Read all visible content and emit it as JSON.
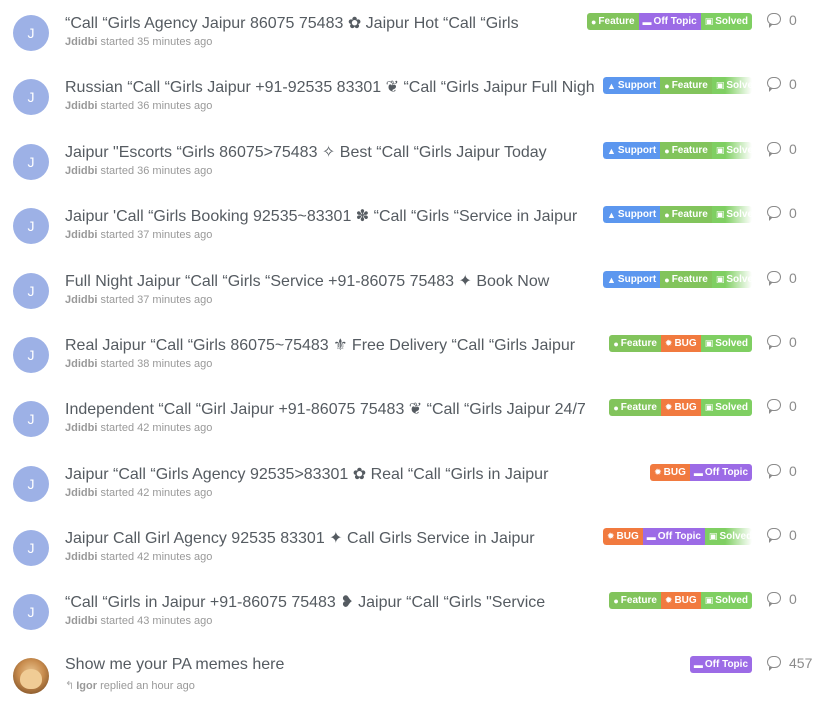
{
  "discussions": [
    {
      "avatar_letter": "J",
      "title": "“Call “Girls Agency Jaipur 86075 75483 ✿ Jaipur Hot “Call “Girls",
      "user": "Jdidbi",
      "action": "started 35 minutes ago",
      "tags": [
        {
          "label": "Feature",
          "kind": "feature",
          "icon": "lightbulb-icon"
        },
        {
          "label": "Off Topic",
          "kind": "offtopic",
          "icon": "chat-icon"
        },
        {
          "label": "Solved",
          "kind": "solved",
          "icon": "clipboard-check-icon"
        }
      ],
      "comments": "0"
    },
    {
      "avatar_letter": "J",
      "title": "Russian “Call “Girls Jaipur +91-92535 83301 ❦ “Call “Girls Jaipur Full Night",
      "user": "Jdidbi",
      "action": "started 36 minutes ago",
      "tags": [
        {
          "label": "Support",
          "kind": "support",
          "icon": "person-icon"
        },
        {
          "label": "Feature",
          "kind": "feature",
          "icon": "lightbulb-icon"
        },
        {
          "label": "Solved",
          "kind": "solved",
          "icon": "clipboard-check-icon"
        }
      ],
      "comments": "0"
    },
    {
      "avatar_letter": "J",
      "title": "Jaipur \"Escorts “Girls 86075>75483 ✧ Best “Call “Girls Jaipur Today",
      "user": "Jdidbi",
      "action": "started 36 minutes ago",
      "tags": [
        {
          "label": "Support",
          "kind": "support",
          "icon": "person-icon"
        },
        {
          "label": "Feature",
          "kind": "feature",
          "icon": "lightbulb-icon"
        },
        {
          "label": "Solved",
          "kind": "solved",
          "icon": "clipboard-check-icon"
        }
      ],
      "comments": "0"
    },
    {
      "avatar_letter": "J",
      "title": "Jaipur 'Call “Girls Booking 92535~83301 ✽ “Call “Girls “Service in Jaipur",
      "user": "Jdidbi",
      "action": "started 37 minutes ago",
      "tags": [
        {
          "label": "Support",
          "kind": "support",
          "icon": "person-icon"
        },
        {
          "label": "Feature",
          "kind": "feature",
          "icon": "lightbulb-icon"
        },
        {
          "label": "Solved",
          "kind": "solved",
          "icon": "clipboard-check-icon"
        }
      ],
      "comments": "0"
    },
    {
      "avatar_letter": "J",
      "title": "Full Night Jaipur “Call “Girls “Service +91-86075 75483 ✦ Book Now",
      "user": "Jdidbi",
      "action": "started 37 minutes ago",
      "tags": [
        {
          "label": "Support",
          "kind": "support",
          "icon": "person-icon"
        },
        {
          "label": "Feature",
          "kind": "feature",
          "icon": "lightbulb-icon"
        },
        {
          "label": "Solved",
          "kind": "solved",
          "icon": "clipboard-check-icon"
        }
      ],
      "comments": "0"
    },
    {
      "avatar_letter": "J",
      "title": "Real Jaipur “Call “Girls 86075~75483 ⚜ Free Delivery “Call “Girls Jaipur",
      "user": "Jdidbi",
      "action": "started 38 minutes ago",
      "tags": [
        {
          "label": "Feature",
          "kind": "feature",
          "icon": "lightbulb-icon"
        },
        {
          "label": "BUG",
          "kind": "bug",
          "icon": "bug-icon"
        },
        {
          "label": "Solved",
          "kind": "solved",
          "icon": "clipboard-check-icon"
        }
      ],
      "comments": "0"
    },
    {
      "avatar_letter": "J",
      "title": "Independent “Call “Girl Jaipur +91-86075 75483 ❦ “Call “Girls Jaipur 24/7",
      "user": "Jdidbi",
      "action": "started 42 minutes ago",
      "tags": [
        {
          "label": "Feature",
          "kind": "feature",
          "icon": "lightbulb-icon"
        },
        {
          "label": "BUG",
          "kind": "bug",
          "icon": "bug-icon"
        },
        {
          "label": "Solved",
          "kind": "solved",
          "icon": "clipboard-check-icon"
        }
      ],
      "comments": "0"
    },
    {
      "avatar_letter": "J",
      "title": "Jaipur “Call “Girls Agency 92535>83301 ✿ Real “Call “Girls in Jaipur",
      "user": "Jdidbi",
      "action": "started 42 minutes ago",
      "tags": [
        {
          "label": "BUG",
          "kind": "bug",
          "icon": "bug-icon"
        },
        {
          "label": "Off Topic",
          "kind": "offtopic",
          "icon": "chat-icon"
        }
      ],
      "comments": "0"
    },
    {
      "avatar_letter": "J",
      "title": "Jaipur Call Girl Agency 92535 83301 ✦ Call Girls Service in Jaipur",
      "user": "Jdidbi",
      "action": "started 42 minutes ago",
      "tags": [
        {
          "label": "BUG",
          "kind": "bug",
          "icon": "bug-icon"
        },
        {
          "label": "Off Topic",
          "kind": "offtopic",
          "icon": "chat-icon"
        },
        {
          "label": "Solved",
          "kind": "solved",
          "icon": "clipboard-check-icon"
        }
      ],
      "comments": "0"
    },
    {
      "avatar_letter": "J",
      "title": "“Call “Girls in Jaipur +91-86075 75483 ❥ Jaipur “Call “Girls \"Service",
      "user": "Jdidbi",
      "action": "started 43 minutes ago",
      "tags": [
        {
          "label": "Feature",
          "kind": "feature",
          "icon": "lightbulb-icon"
        },
        {
          "label": "BUG",
          "kind": "bug",
          "icon": "bug-icon"
        },
        {
          "label": "Solved",
          "kind": "solved",
          "icon": "clipboard-check-icon"
        }
      ],
      "comments": "0"
    },
    {
      "avatar_letter": "",
      "avatar_photo": true,
      "title": "Show me your PA memes here",
      "user": "Igor",
      "action": "replied an hour ago",
      "reply": true,
      "tags": [
        {
          "label": "Off Topic",
          "kind": "offtopic",
          "icon": "chat-icon"
        }
      ],
      "comments": "457"
    }
  ],
  "colors": {
    "support": "#5c97ef",
    "feature": "#82c45c",
    "offtopic": "#9c6be6",
    "bug": "#f17a3f",
    "solved": "#7fcf62",
    "avatar": "#9db1e6"
  }
}
